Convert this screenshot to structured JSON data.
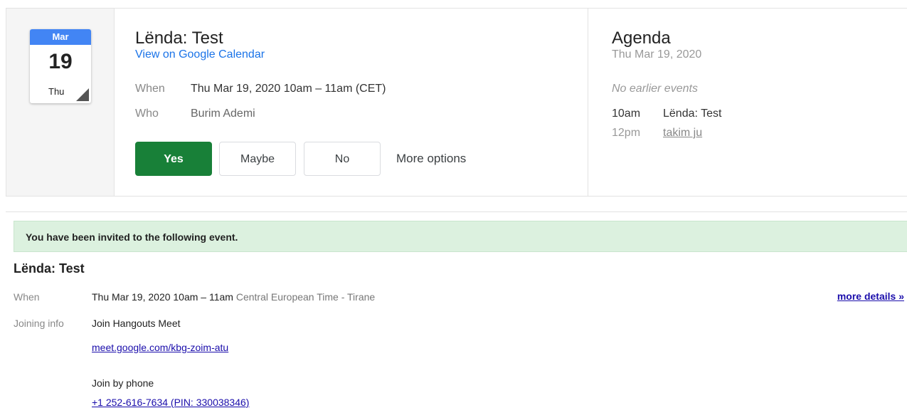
{
  "calendar_icon": {
    "month": "Mar",
    "day": "19",
    "weekday": "Thu"
  },
  "event": {
    "title": "Lënda: Test",
    "view_link": "View on Google Calendar",
    "when_label": "When",
    "when_value": "Thu Mar 19, 2020 10am – 11am (CET)",
    "who_label": "Who",
    "who_value": "Burim Ademi"
  },
  "rsvp": {
    "yes": "Yes",
    "maybe": "Maybe",
    "no": "No",
    "more_options": "More options"
  },
  "agenda": {
    "title": "Agenda",
    "date": "Thu Mar 19, 2020",
    "no_earlier": "No earlier events",
    "items": [
      {
        "time": "10am",
        "title": "Lënda: Test"
      },
      {
        "time": "12pm",
        "title": "takim ju"
      }
    ]
  },
  "invitation": {
    "banner": "You have been invited to the following event.",
    "title": "Lënda: Test",
    "when_label": "When",
    "when_value": "Thu Mar 19, 2020 10am – 11am",
    "when_tz": "Central European Time - Tirane",
    "more_details": "more details »",
    "joining_label": "Joining info",
    "join_meet": "Join Hangouts Meet",
    "meet_link": "meet.google.com/kbg-zoim-atu",
    "join_phone": "Join by phone",
    "phone_line": "+1 252-616-7634 (PIN: 330038346)"
  },
  "colors": {
    "accent_blue": "#4285f4",
    "yes_green": "#188038",
    "banner_green": "#dcf1df",
    "link": "#1a73e8"
  }
}
